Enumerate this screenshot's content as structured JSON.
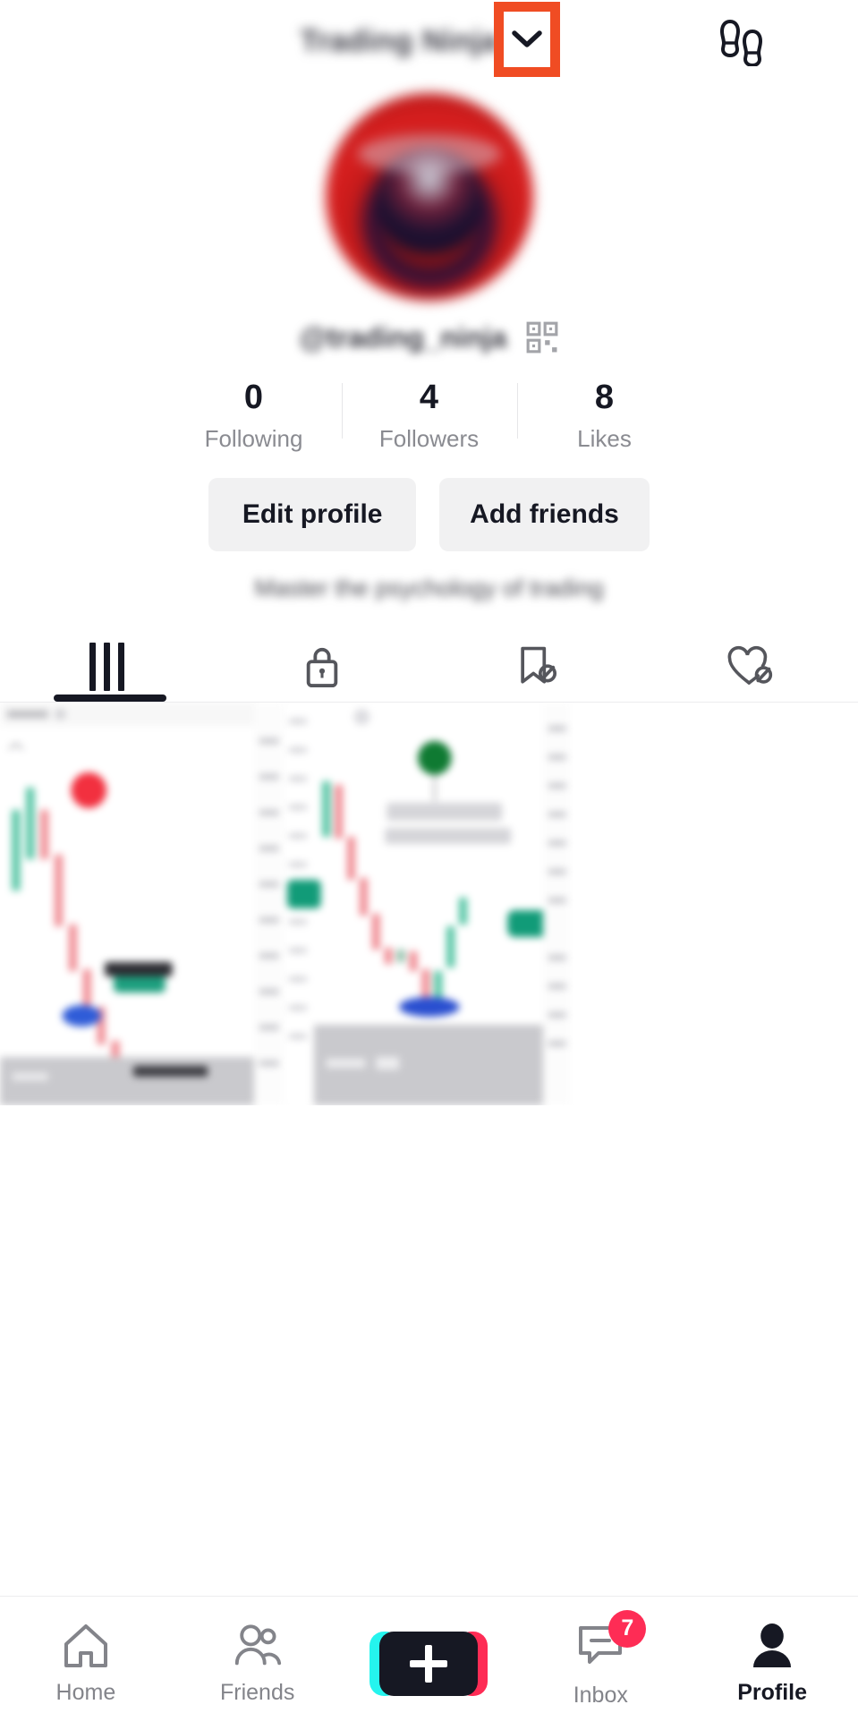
{
  "header": {
    "title": "Trading Ninja",
    "dropdown_icon": "chevron-down-icon",
    "footprints_icon": "footprints-icon",
    "menu_icon": "hamburger-menu-icon",
    "annotation_color": "#f04c23"
  },
  "profile": {
    "avatar_alt": "profile-avatar",
    "username": "@trading_ninja",
    "qr_icon": "qr-code-icon",
    "bio": "Master the psychology of trading",
    "stats": [
      {
        "value": "0",
        "label": "Following"
      },
      {
        "value": "4",
        "label": "Followers"
      },
      {
        "value": "8",
        "label": "Likes"
      }
    ],
    "buttons": [
      {
        "label": "Edit profile",
        "name": "edit-profile-button"
      },
      {
        "label": "Add friends",
        "name": "add-friends-button"
      }
    ]
  },
  "tabs": [
    {
      "name": "tab-posts",
      "icon": "grid-icon",
      "active": true
    },
    {
      "name": "tab-private",
      "icon": "lock-icon",
      "active": false
    },
    {
      "name": "tab-saved",
      "icon": "bookmark-slash-icon",
      "active": false
    },
    {
      "name": "tab-liked",
      "icon": "heart-slash-icon",
      "active": false
    }
  ],
  "video_grid": [
    {
      "name": "video-thumbnail-1",
      "type": "candlestick-chart"
    },
    {
      "name": "video-thumbnail-2",
      "type": "candlestick-chart"
    },
    {
      "name": "video-thumbnail-3",
      "type": "empty"
    }
  ],
  "bottom_nav": [
    {
      "label": "Home",
      "icon": "home-icon",
      "name": "nav-home",
      "active": false,
      "badge": null
    },
    {
      "label": "Friends",
      "icon": "friends-icon",
      "name": "nav-friends",
      "active": false,
      "badge": null
    },
    {
      "label": "",
      "icon": "plus-icon",
      "name": "nav-create",
      "active": false,
      "badge": null
    },
    {
      "label": "Inbox",
      "icon": "inbox-icon",
      "name": "nav-inbox",
      "active": false,
      "badge": "7"
    },
    {
      "label": "Profile",
      "icon": "person-icon",
      "name": "nav-profile",
      "active": true,
      "badge": null
    }
  ],
  "colors": {
    "accent_pink": "#fe2c55",
    "accent_cyan": "#25f4ee",
    "dark": "#161823",
    "muted": "#83848a",
    "button_bg": "#f1f1f2",
    "annotation": "#f04c23"
  }
}
